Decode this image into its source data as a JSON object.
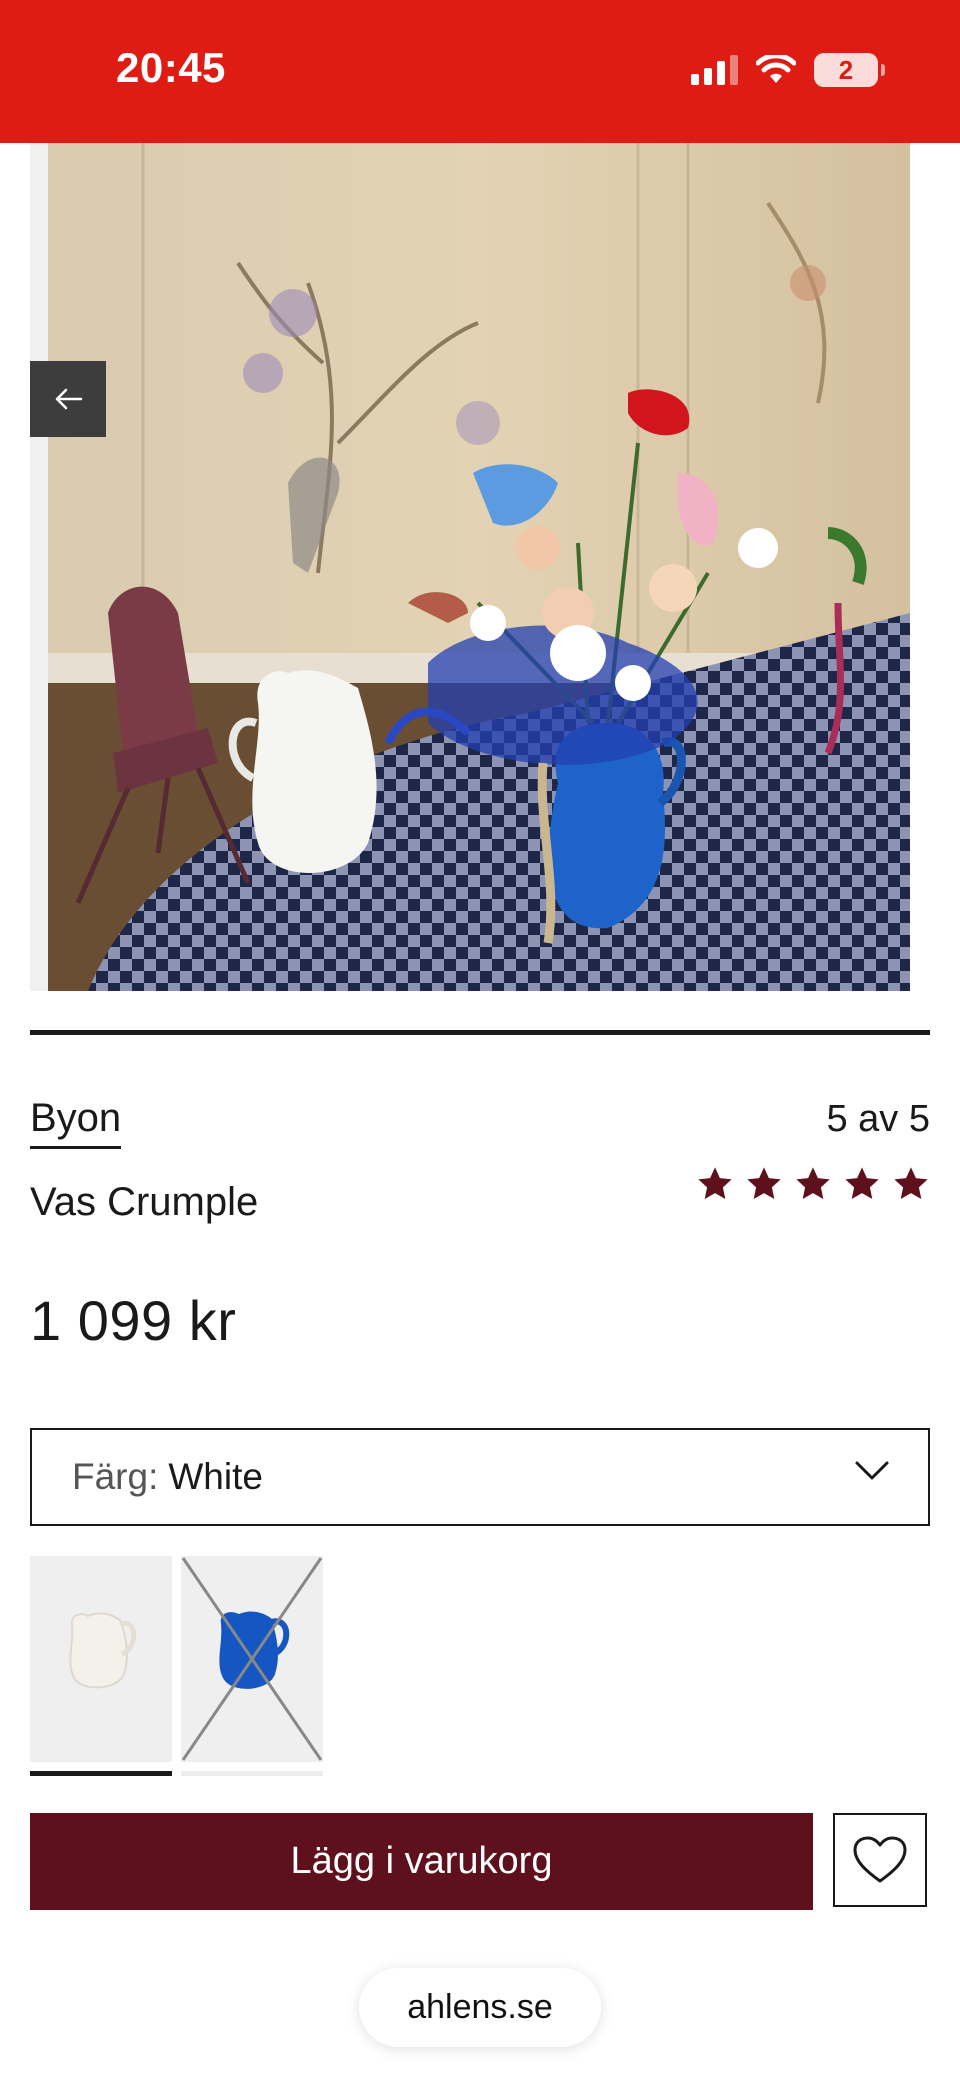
{
  "status_bar": {
    "time": "20:45",
    "battery": "2",
    "icons": [
      "signal-icon",
      "wifi-icon",
      "battery-icon"
    ]
  },
  "gallery": {
    "image_alt": "Vas Crumple",
    "prev_icon": "arrow-left-icon"
  },
  "product": {
    "brand": "Byon",
    "name": "Vas Crumple",
    "price": "1 099 kr",
    "rating_text": "5 av 5",
    "rating_value": 5,
    "rating_max": 5
  },
  "color_select": {
    "label": "Färg:",
    "value": "White",
    "icon": "chevron-down-icon"
  },
  "swatches": [
    {
      "color": "White",
      "selected": true,
      "available": true
    },
    {
      "color": "Blue",
      "selected": false,
      "available": false
    }
  ],
  "actions": {
    "add_to_cart": "Lägg i varukorg",
    "wishlist_icon": "heart-icon"
  },
  "browser": {
    "url": "ahlens.se"
  },
  "colors": {
    "status_bar": "#df1c13",
    "primary_button": "#5e111c",
    "stars": "#5e111c"
  }
}
